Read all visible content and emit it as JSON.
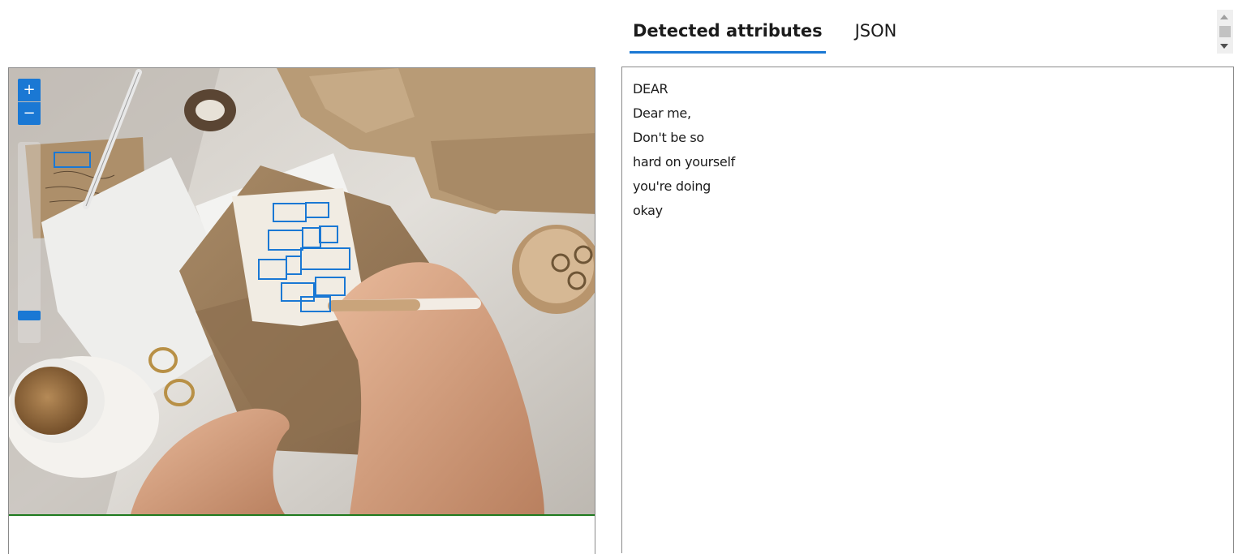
{
  "viewer": {
    "zoom_in_label": "+",
    "zoom_out_label": "−",
    "zoom_level": 0.1
  },
  "tabs": [
    {
      "label": "Detected attributes",
      "active": true
    },
    {
      "label": "JSON",
      "active": false
    }
  ],
  "results": {
    "lines": [
      "DEAR",
      "Dear me,",
      "Don't be so",
      "hard on yourself",
      "you're doing",
      "okay"
    ]
  },
  "colors": {
    "accent": "#1a78d4",
    "bounding_box": "#1a78d4"
  }
}
